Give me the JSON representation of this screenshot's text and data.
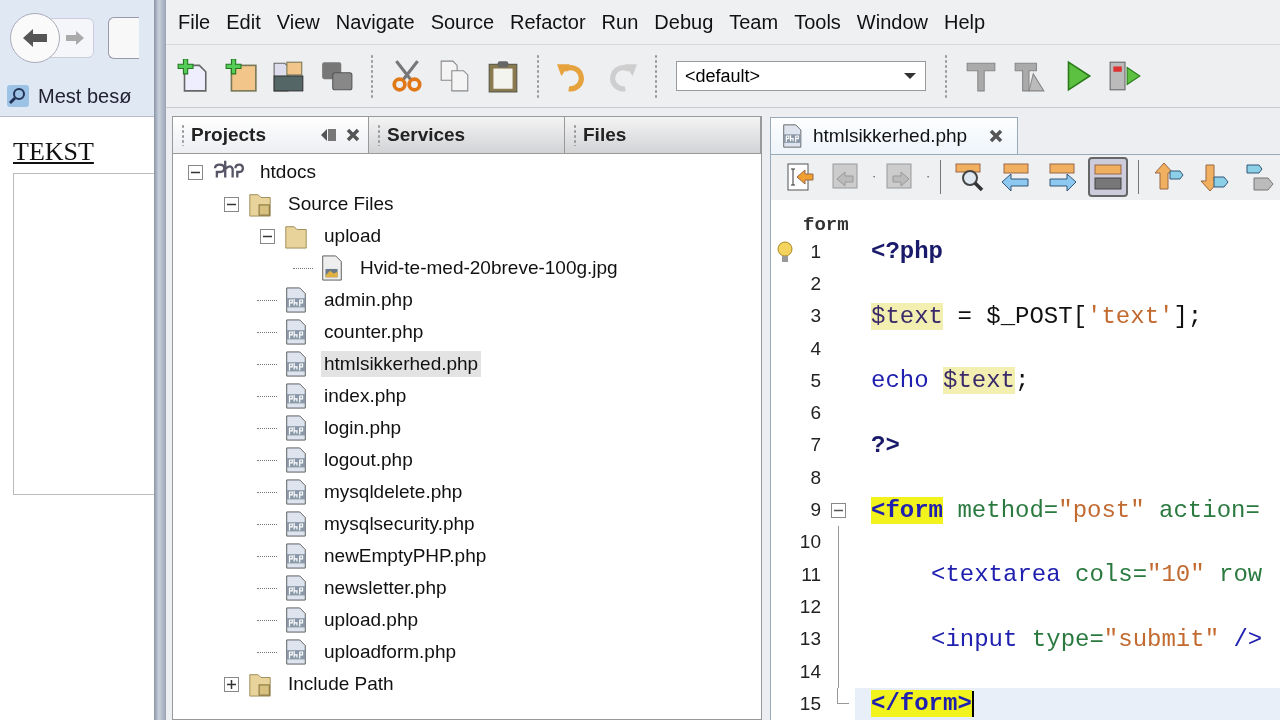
{
  "browser": {
    "bookmarks_label": "Mest besø",
    "page_label": "TEKST"
  },
  "window": {
    "menu": [
      "File",
      "Edit",
      "View",
      "Navigate",
      "Source",
      "Refactor",
      "Run",
      "Debug",
      "Team",
      "Tools",
      "Window",
      "Help"
    ],
    "toolbar": [
      {
        "kind": "new-file",
        "disabled": false
      },
      {
        "kind": "new-project",
        "disabled": false
      },
      {
        "kind": "open-project",
        "disabled": false
      },
      {
        "kind": "close-project",
        "disabled": false
      },
      {
        "kind": "sep"
      },
      {
        "kind": "cut",
        "disabled": false
      },
      {
        "kind": "copy",
        "disabled": false
      },
      {
        "kind": "paste",
        "disabled": false
      },
      {
        "kind": "sep"
      },
      {
        "kind": "undo",
        "disabled": false
      },
      {
        "kind": "redo",
        "disabled": true
      },
      {
        "kind": "sep"
      },
      {
        "kind": "config",
        "value": "<default>"
      },
      {
        "kind": "sep"
      },
      {
        "kind": "build",
        "disabled": false
      },
      {
        "kind": "clean-build",
        "disabled": false
      },
      {
        "kind": "run",
        "disabled": false
      },
      {
        "kind": "debug",
        "disabled": false
      }
    ]
  },
  "projects_panel": {
    "tabs": [
      {
        "label": "Projects",
        "selected": true
      },
      {
        "label": "Services",
        "selected": false
      },
      {
        "label": "Files",
        "selected": false
      }
    ],
    "tree": [
      {
        "label": "htdocs",
        "kind": "project",
        "expanded": true,
        "selected": false,
        "children": [
          {
            "label": "Source Files",
            "kind": "source",
            "expanded": true,
            "selected": false,
            "children": [
              {
                "label": "upload",
                "kind": "folder",
                "expanded": true,
                "selected": false,
                "children": [
                  {
                    "label": "Hvid-te-med-20breve-100g.jpg",
                    "kind": "image",
                    "selected": false
                  }
                ]
              },
              {
                "label": "admin.php",
                "kind": "php",
                "selected": false
              },
              {
                "label": "counter.php",
                "kind": "php",
                "selected": false
              },
              {
                "label": "htmlsikkerhed.php",
                "kind": "php",
                "selected": true
              },
              {
                "label": "index.php",
                "kind": "php",
                "selected": false
              },
              {
                "label": "login.php",
                "kind": "php",
                "selected": false
              },
              {
                "label": "logout.php",
                "kind": "php",
                "selected": false
              },
              {
                "label": "mysqldelete.php",
                "kind": "php",
                "selected": false
              },
              {
                "label": "mysqlsecurity.php",
                "kind": "php",
                "selected": false
              },
              {
                "label": "newEmptyPHP.php",
                "kind": "php",
                "selected": false
              },
              {
                "label": "newsletter.php",
                "kind": "php",
                "selected": false
              },
              {
                "label": "upload.php",
                "kind": "php",
                "selected": false
              },
              {
                "label": "uploadform.php",
                "kind": "php",
                "selected": false
              }
            ]
          },
          {
            "label": "Include Path",
            "kind": "source",
            "expanded": false,
            "selected": false
          }
        ]
      }
    ]
  },
  "editor": {
    "tabs": [
      {
        "label": "htmlsikkerhed.php",
        "selected": true
      }
    ],
    "toolbar": [
      {
        "kind": "last-edit",
        "pressed": false
      },
      {
        "kind": "back",
        "pressed": false
      },
      {
        "kind": "forward",
        "pressed": false
      },
      {
        "kind": "sep"
      },
      {
        "kind": "find",
        "pressed": false
      },
      {
        "kind": "find-prev",
        "pressed": false
      },
      {
        "kind": "find-next",
        "pressed": false
      },
      {
        "kind": "toggle-highlight",
        "pressed": true
      },
      {
        "kind": "sep"
      },
      {
        "kind": "prev-bookmark",
        "pressed": false
      },
      {
        "kind": "next-bookmark",
        "pressed": false
      },
      {
        "kind": "toggle-bookmark",
        "pressed": false
      }
    ],
    "breadcrumb": "form",
    "lines": [
      {
        "number": "1",
        "hint": true,
        "tokens": [
          {
            "text": "<?php",
            "kind": "delim"
          }
        ]
      },
      {
        "number": "2"
      },
      {
        "number": "3",
        "tokens": [
          {
            "text": "$text",
            "kind": "var-mark"
          },
          {
            "text": " = $_POST[",
            "kind": "plain"
          },
          {
            "text": "'text'",
            "kind": "str"
          },
          {
            "text": "];",
            "kind": "plain"
          }
        ]
      },
      {
        "number": "4"
      },
      {
        "number": "5",
        "tokens": [
          {
            "text": "echo",
            "kind": "keyword"
          },
          {
            "text": "$text",
            "kind": "var-mark"
          },
          {
            "text": ";",
            "kind": "plain"
          }
        ]
      },
      {
        "number": "6"
      },
      {
        "number": "7",
        "tokens": [
          {
            "text": "?>",
            "kind": "delim"
          }
        ]
      },
      {
        "number": "8"
      },
      {
        "number": "9",
        "fold_start": true,
        "tokens": [
          {
            "text": "<form",
            "kind": "tag-match"
          },
          {
            "text": " method=",
            "kind": "attr"
          },
          {
            "text": "\"post\"",
            "kind": "str"
          },
          {
            "text": " action=",
            "kind": "attr"
          }
        ]
      },
      {
        "number": "10",
        "in_fold": true
      },
      {
        "number": "11",
        "in_fold": true,
        "indented": true,
        "tokens": [
          {
            "text": "<textarea",
            "kind": "tag"
          },
          {
            "text": " cols=",
            "kind": "attr"
          },
          {
            "text": "\"10\"",
            "kind": "str"
          },
          {
            "text": " row",
            "kind": "attr"
          }
        ]
      },
      {
        "number": "12",
        "in_fold": true
      },
      {
        "number": "13",
        "in_fold": true,
        "indented": true,
        "tokens": [
          {
            "text": "<input",
            "kind": "tag"
          },
          {
            "text": " type=",
            "kind": "attr"
          },
          {
            "text": "\"submit\"",
            "kind": "str"
          },
          {
            "text": " />",
            "kind": "tag"
          }
        ]
      },
      {
        "number": "14",
        "in_fold": true
      },
      {
        "number": "15",
        "fold_end": true,
        "current": true,
        "tokens": [
          {
            "text": "</form>",
            "kind": "tag-match"
          }
        ]
      }
    ]
  }
}
